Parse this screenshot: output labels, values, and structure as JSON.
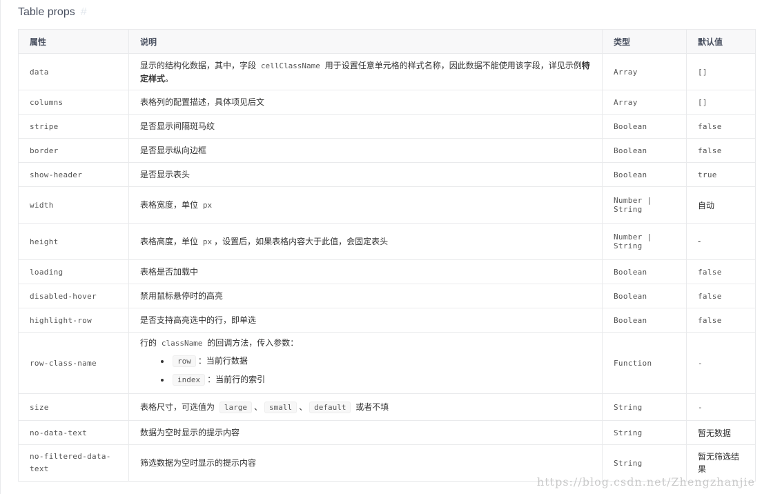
{
  "section": {
    "title": "Table props",
    "anchor": "#"
  },
  "table": {
    "headers": {
      "attr": "属性",
      "desc": "说明",
      "type": "类型",
      "default": "默认值"
    },
    "rows": [
      {
        "name": "data",
        "desc_before": "显示的结构化数据，其中，字段 ",
        "desc_code": "cellClassName",
        "desc_after": " 用于设置任意单元格的样式名称，因此数据不能使用该字段，详见示例",
        "desc_bold": "特定样式",
        "desc_end": "。",
        "type": "Array",
        "default": "[]"
      },
      {
        "name": "columns",
        "desc": "表格列的配置描述，具体项见后文",
        "type": "Array",
        "default": "[]"
      },
      {
        "name": "stripe",
        "desc": "是否显示间隔斑马纹",
        "type": "Boolean",
        "default": "false"
      },
      {
        "name": "border",
        "desc": "是否显示纵向边框",
        "type": "Boolean",
        "default": "false"
      },
      {
        "name": "show-header",
        "desc": "是否显示表头",
        "type": "Boolean",
        "default": "true"
      },
      {
        "name": "width",
        "desc_before": "表格宽度，单位 ",
        "desc_code": "px",
        "type_line1": "Number |",
        "type_line2": "String",
        "default": "自动"
      },
      {
        "name": "height",
        "desc_before": "表格高度，单位 ",
        "desc_code": "px",
        "desc_after": "，设置后，如果表格内容大于此值，会固定表头",
        "type_line1": "Number |",
        "type_line2": "String",
        "default": "-"
      },
      {
        "name": "loading",
        "desc": "表格是否加载中",
        "type": "Boolean",
        "default": "false"
      },
      {
        "name": "disabled-hover",
        "desc": "禁用鼠标悬停时的高亮",
        "type": "Boolean",
        "default": "false"
      },
      {
        "name": "highlight-row",
        "desc": "是否支持高亮选中的行，即单选",
        "type": "Boolean",
        "default": "false"
      },
      {
        "name": "row-class-name",
        "desc_before": "行的 ",
        "desc_code": "className",
        "desc_after": " 的回调方法，传入参数：",
        "items": [
          {
            "code": "row",
            "text": "：当前行数据"
          },
          {
            "code": "index",
            "text": "：当前行的索引"
          }
        ],
        "type": "Function",
        "default": "-"
      },
      {
        "name": "size",
        "desc_before": "表格尺寸，可选值为 ",
        "opts": [
          "large",
          "small",
          "default"
        ],
        "sep": "、",
        "desc_after": " 或者不填",
        "type": "String",
        "default": "-"
      },
      {
        "name": "no-data-text",
        "desc": "数据为空时显示的提示内容",
        "type": "String",
        "default": "暂无数据"
      },
      {
        "name": "no-filtered-data-text",
        "desc": "筛选数据为空时显示的提示内容",
        "type": "String",
        "default": "暂无筛选结果"
      }
    ]
  },
  "watermark": "https://blog.csdn.net/Zhengzhanjie"
}
